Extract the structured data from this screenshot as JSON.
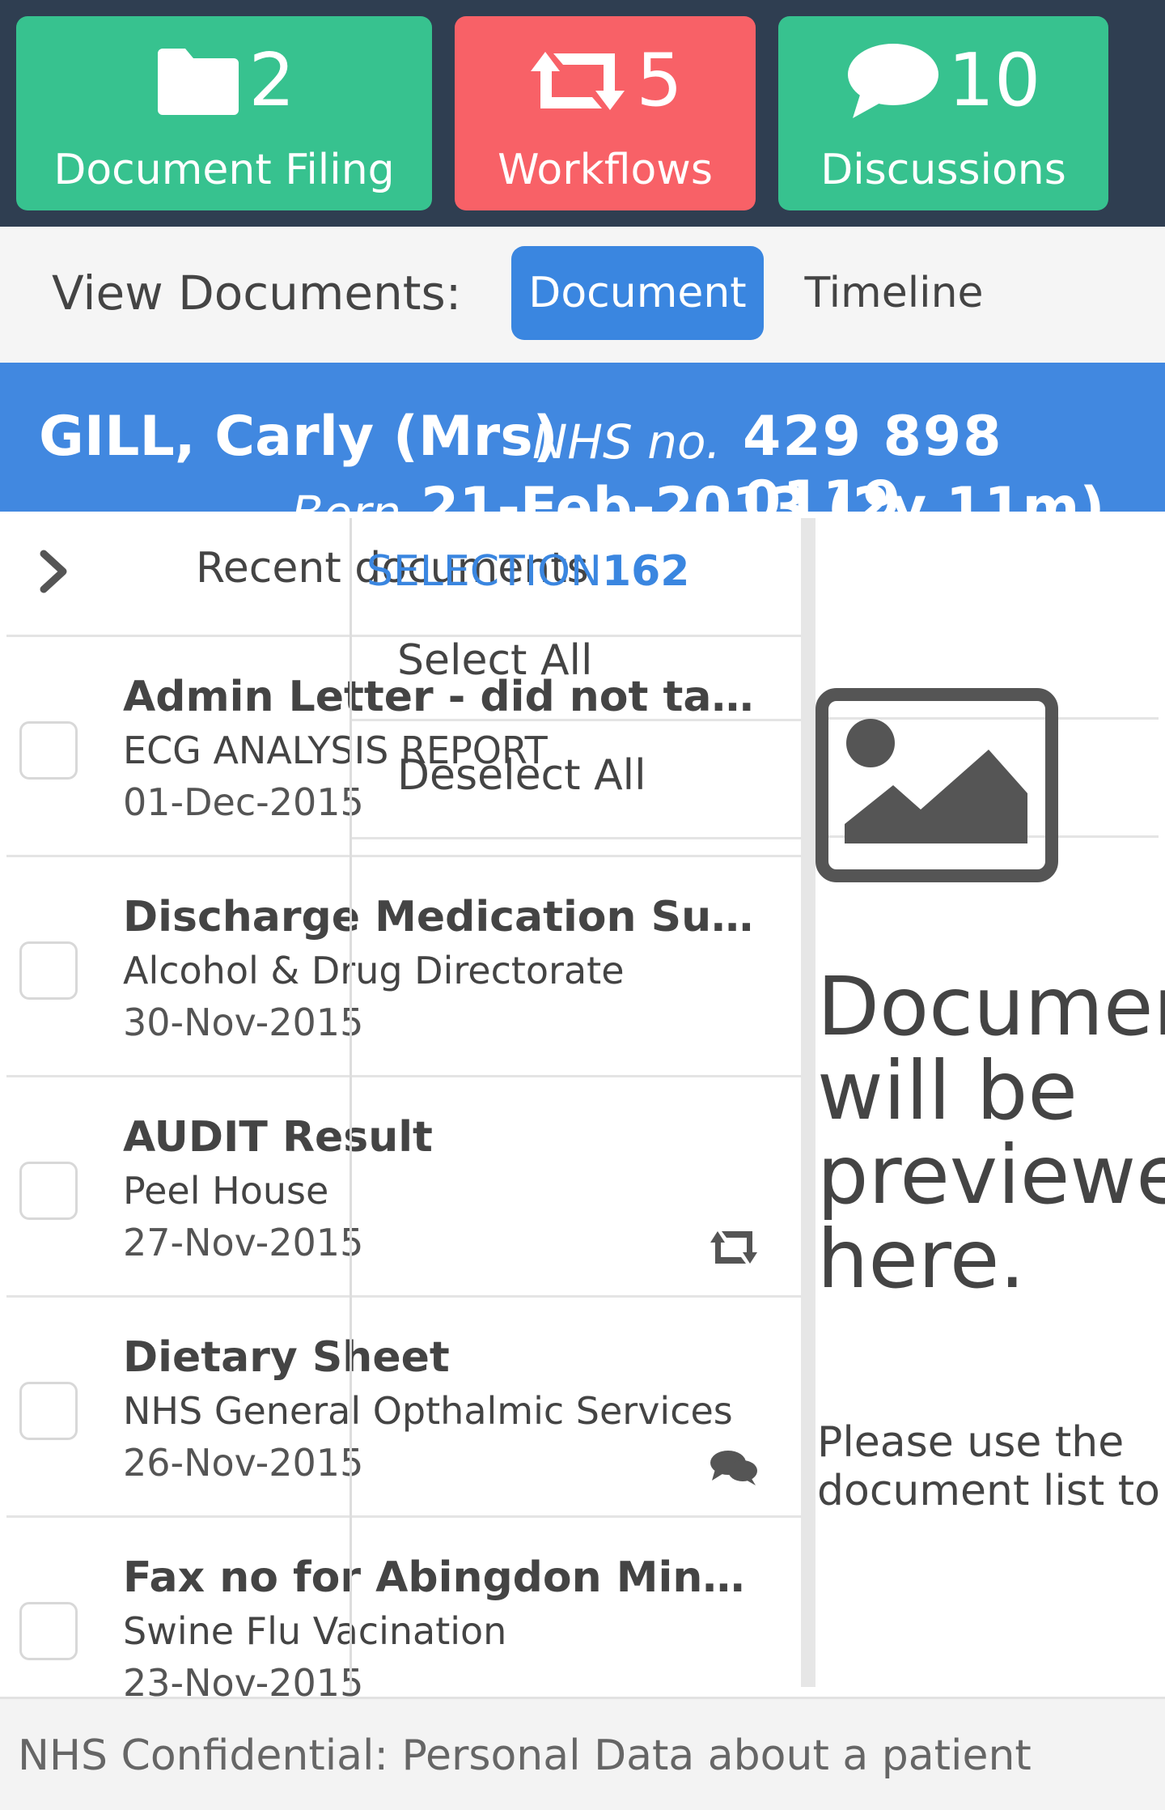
{
  "tiles": {
    "filing": {
      "count": "2",
      "label": "Document Filing",
      "icon": "folder-icon"
    },
    "workflows": {
      "count": "5",
      "label": "Workflows",
      "icon": "retweet-icon"
    },
    "discussions": {
      "count": "10",
      "label": "Discussions",
      "icon": "comment-icon"
    }
  },
  "view_bar": {
    "label": "View Documents:",
    "document_button": "Document",
    "timeline_button": "Timeline"
  },
  "patient": {
    "name": "GILL, Carly (Mrs)",
    "nhs_label": "NHS no.",
    "nhs_number": "429 898 0119",
    "born_label": "Born",
    "born_value": "21-Feb-2013 (2y 11m)"
  },
  "list": {
    "header": "Recent documents",
    "items": [
      {
        "title": "Admin Letter - did not take up…",
        "source": "ECG ANALYSIS REPORT",
        "date": "01-Dec-2015",
        "icon": ""
      },
      {
        "title": "Discharge Medication Summ…",
        "source": "Alcohol & Drug Directorate",
        "date": "30-Nov-2015",
        "icon": ""
      },
      {
        "title": "AUDIT Result",
        "source": "Peel House",
        "date": "27-Nov-2015",
        "icon": "retweet-icon"
      },
      {
        "title": "Dietary Sheet",
        "source": "NHS General Opthalmic Services",
        "date": "26-Nov-2015",
        "icon": "comments-icon"
      },
      {
        "title": "Fax no for Abingdon Minor Inj…",
        "source": "Swine Flu Vacination",
        "date": "23-Nov-2015",
        "icon": ""
      }
    ]
  },
  "selection": {
    "title": "SELECTION",
    "count": "162",
    "select_all": "Select All",
    "deselect_all": "Deselect All"
  },
  "preview": {
    "heading": "Document will be previewed here.",
    "subtext": "Please use the document list to"
  },
  "footer": {
    "text": "NHS Confidential: Personal Data about a patient"
  },
  "colors": {
    "topbar": "#2f3e51",
    "green": "#37c28f",
    "red": "#f86167",
    "blue": "#4188e0",
    "button_blue": "#3a86e0"
  }
}
